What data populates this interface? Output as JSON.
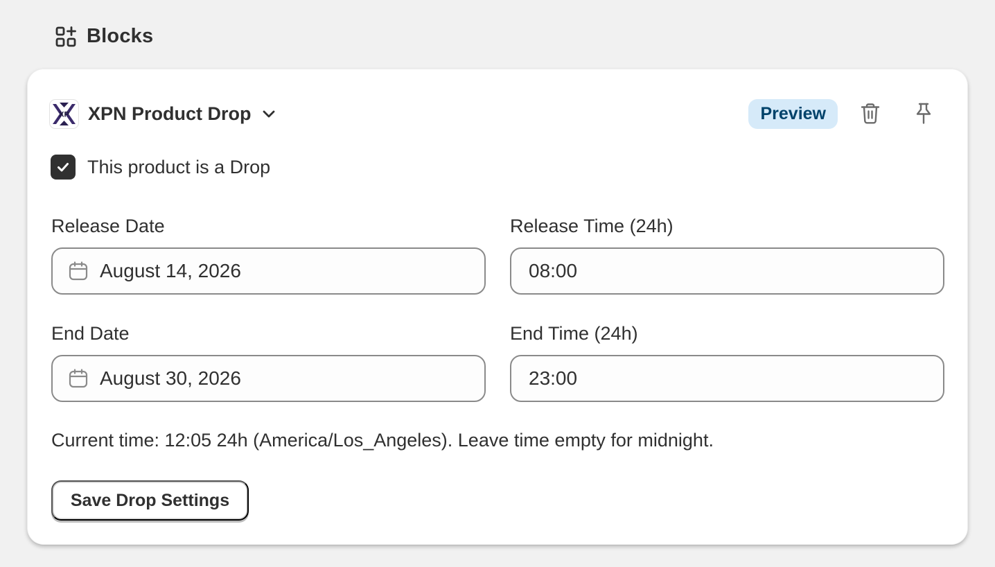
{
  "section": {
    "title": "Blocks",
    "icon": "blocks-icon"
  },
  "block": {
    "app_name": "XPN Product Drop",
    "logo_text": "XP",
    "preview_label": "Preview",
    "icons": {
      "trash": "trash-icon",
      "pin": "pin-icon",
      "expand": "chevron-down-icon"
    },
    "colors": {
      "preview_bg": "#d6eaf9",
      "preview_text": "#00426a",
      "checkbox": "#303030"
    }
  },
  "form": {
    "is_drop": {
      "label": "This product is a Drop",
      "checked": true
    },
    "release_date": {
      "label": "Release Date",
      "value": "August 14, 2026"
    },
    "release_time": {
      "label": "Release Time (24h)",
      "value": "08:00"
    },
    "end_date": {
      "label": "End Date",
      "value": "August 30, 2026"
    },
    "end_time": {
      "label": "End Time (24h)",
      "value": "23:00"
    },
    "help_text": "Current time: 12:05 24h (America/Los_Angeles). Leave time empty for midnight.",
    "save_label": "Save Drop Settings"
  }
}
